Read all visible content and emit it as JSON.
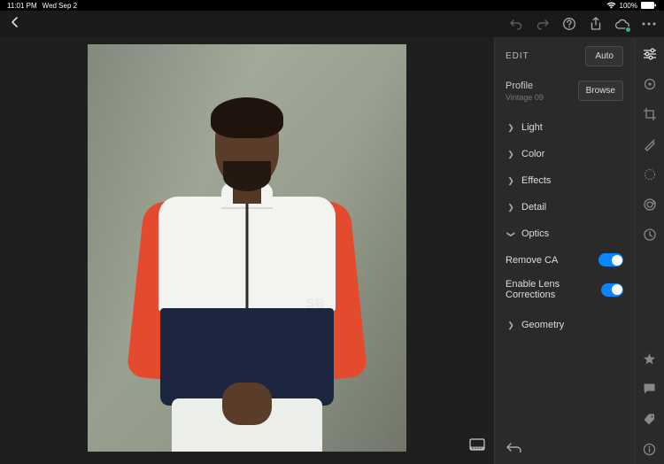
{
  "status": {
    "time": "11:01 PM",
    "date": "Wed Sep 2",
    "battery_pct": "100%"
  },
  "edit_panel": {
    "title": "EDIT",
    "auto_label": "Auto",
    "profile_label": "Profile",
    "profile_value": "Vintage 09",
    "browse_label": "Browse",
    "sections": {
      "light": "Light",
      "color": "Color",
      "effects": "Effects",
      "detail": "Detail",
      "optics": "Optics",
      "geometry": "Geometry"
    },
    "optics": {
      "remove_ca_label": "Remove CA",
      "lens_corr_label": "Enable Lens Corrections"
    }
  },
  "photo": {
    "brand_text": "SB"
  }
}
